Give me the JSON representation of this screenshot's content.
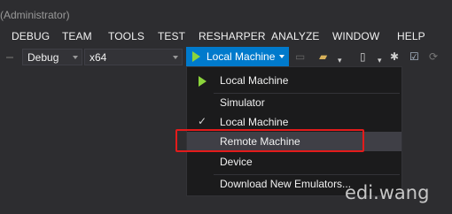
{
  "window": {
    "title": "(Administrator)"
  },
  "menu": [
    "DEBUG",
    "TEAM",
    "TOOLS",
    "TEST",
    "RESHARPER",
    "ANALYZE",
    "WINDOW",
    "HELP"
  ],
  "toolbar": {
    "configuration": "Debug",
    "platform": "x64",
    "run_target": "Local Machine"
  },
  "dropdown": {
    "items": [
      {
        "label": "Local Machine",
        "icon": "play-icon",
        "state": "default"
      },
      {
        "label": "Simulator",
        "icon": "",
        "state": ""
      },
      {
        "label": "Local Machine",
        "icon": "check-icon",
        "state": "checked"
      },
      {
        "label": "Remote Machine",
        "icon": "",
        "state": "hover"
      },
      {
        "label": "Device",
        "icon": "",
        "state": ""
      },
      {
        "label": "Download New Emulators...",
        "icon": "",
        "state": ""
      }
    ]
  },
  "watermark": "edi.wang",
  "colors": {
    "accent": "#007acc",
    "highlight": "#e31b1b",
    "play": "#8bd43b"
  }
}
